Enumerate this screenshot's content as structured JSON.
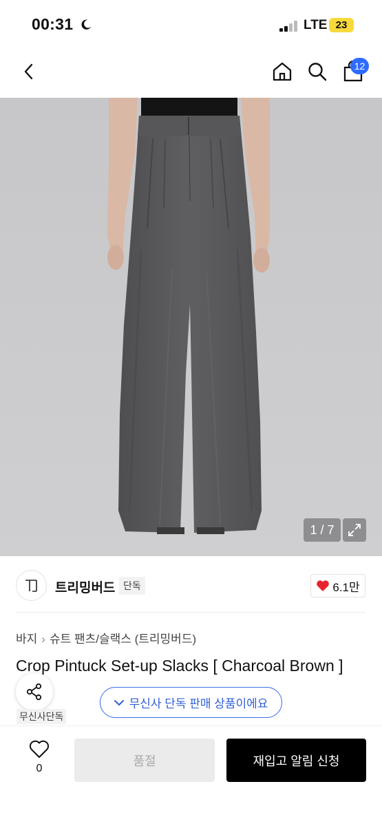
{
  "status_bar": {
    "time": "00:31",
    "network": "LTE",
    "battery": "23"
  },
  "nav": {
    "cart_count": "12"
  },
  "gallery": {
    "counter": "1 / 7"
  },
  "brand": {
    "name": "트리밍버드",
    "tag": "단독",
    "likes": "6.1만",
    "logo_text": "TB"
  },
  "breadcrumb": [
    "바지",
    "슈트 팬츠/슬랙스 (트리밍버드)"
  ],
  "product": {
    "title": "Crop Pintuck Set-up Slacks [ Charcoal Brown ]"
  },
  "exclusive": {
    "badge": "무신사단독",
    "pill": "무신사 단독 판매 상품이에요"
  },
  "bottom": {
    "wish_count": "0",
    "soldout_label": "품절",
    "restock_label": "재입고 알림 신청"
  },
  "colors": {
    "accent_blue": "#2f6bff",
    "like_red": "#e8242f",
    "pants": "#5a5a5c",
    "background_photo": "#c9c9cb"
  }
}
